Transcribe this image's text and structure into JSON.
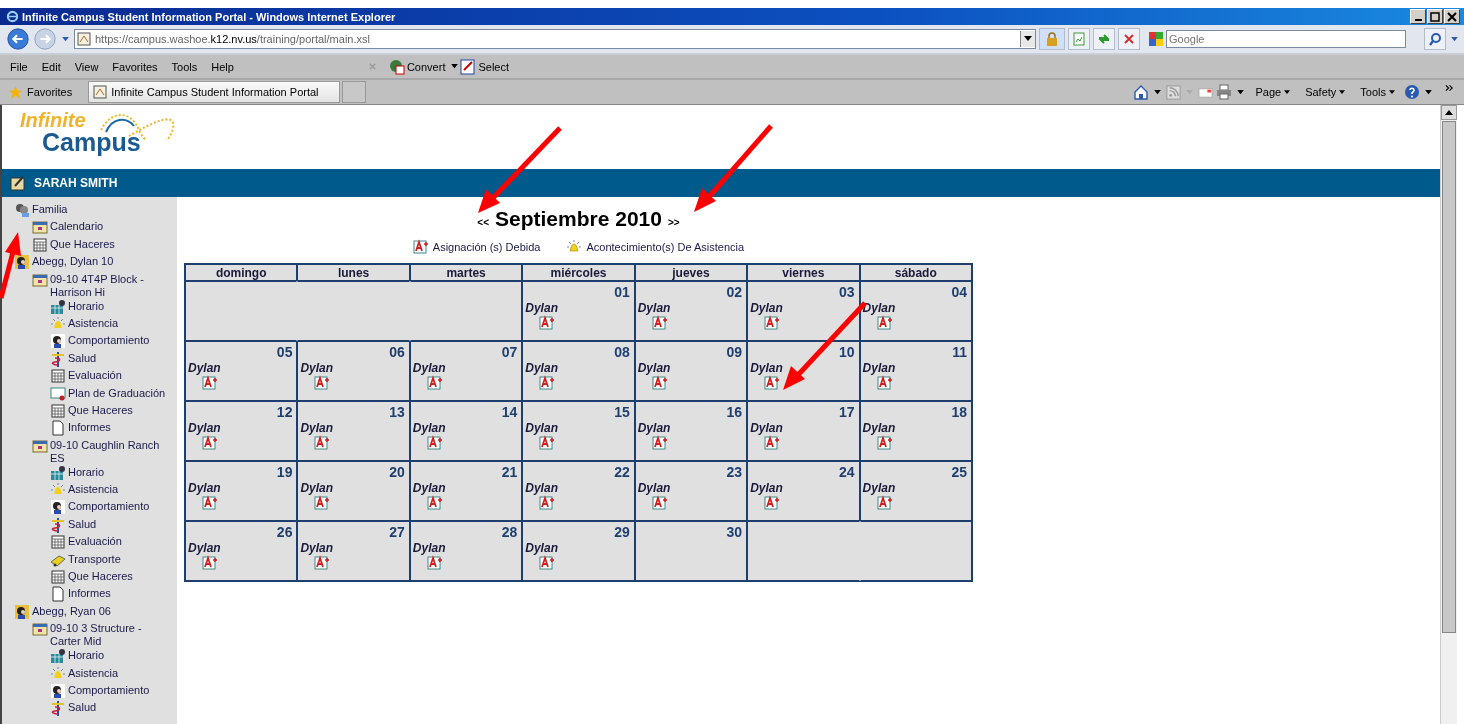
{
  "window": {
    "title": "Infinite Campus Student Information Portal - Windows Internet Explorer"
  },
  "address_bar": {
    "scheme": "https://campus.washoe.",
    "domain": "k12.nv.us",
    "path": "/training/portal/main.xsl"
  },
  "search": {
    "placeholder": "Google"
  },
  "menu": [
    "File",
    "Edit",
    "View",
    "Favorites",
    "Tools",
    "Help"
  ],
  "command_bar": [
    {
      "kind": "convert",
      "label": "Convert"
    },
    {
      "kind": "select",
      "label": "Select"
    }
  ],
  "favorites": {
    "label": "Favorites"
  },
  "tab": {
    "title": "Infinite Campus Student Information Portal"
  },
  "command_menus": [
    "Page",
    "Safety",
    "Tools"
  ],
  "logo": {
    "line1": "Infinite",
    "line2": "Campus"
  },
  "user_bar": {
    "name": "SARAH SMITH"
  },
  "sidebar": {
    "items": [
      {
        "label": "Familia",
        "kind": "family",
        "children": [
          {
            "label": "Calendario",
            "kind": "calendar"
          },
          {
            "label": "Que Haceres",
            "kind": "grid"
          }
        ]
      },
      {
        "label": "Abegg, Dylan 10",
        "kind": "student",
        "children": [
          {
            "label": "09-10 4T4P Block - Harrison Hi",
            "kind": "calendar",
            "children": [
              {
                "label": "Horario",
                "kind": "schedule"
              },
              {
                "label": "Asistencia",
                "kind": "bell"
              },
              {
                "label": "Comportamiento",
                "kind": "behavior"
              },
              {
                "label": "Salud",
                "kind": "health"
              },
              {
                "label": "Evaluación",
                "kind": "grid"
              },
              {
                "label": "Plan de Graduación",
                "kind": "certificate"
              },
              {
                "label": "Que Haceres",
                "kind": "grid"
              },
              {
                "label": "Informes",
                "kind": "document"
              }
            ]
          },
          {
            "label": "09-10 Caughlin Ranch ES",
            "kind": "calendar",
            "children": [
              {
                "label": "Horario",
                "kind": "schedule"
              },
              {
                "label": "Asistencia",
                "kind": "bell"
              },
              {
                "label": "Comportamiento",
                "kind": "behavior"
              },
              {
                "label": "Salud",
                "kind": "health"
              },
              {
                "label": "Evaluación",
                "kind": "grid"
              },
              {
                "label": "Transporte",
                "kind": "bus"
              },
              {
                "label": "Que Haceres",
                "kind": "grid"
              },
              {
                "label": "Informes",
                "kind": "document"
              }
            ]
          }
        ]
      },
      {
        "label": "Abegg, Ryan 06",
        "kind": "student",
        "children": [
          {
            "label": "09-10 3 Structure - Carter Mid",
            "kind": "calendar",
            "children": [
              {
                "label": "Horario",
                "kind": "schedule"
              },
              {
                "label": "Asistencia",
                "kind": "bell"
              },
              {
                "label": "Comportamiento",
                "kind": "behavior"
              },
              {
                "label": "Salud",
                "kind": "health"
              }
            ]
          }
        ]
      }
    ]
  },
  "calendar": {
    "prev": "<<",
    "title": "Septiembre 2010",
    "next": ">>",
    "legend": [
      {
        "kind": "assignment",
        "label": "Asignación (s) Debida"
      },
      {
        "kind": "attendance",
        "label": "Acontecimiento(s) De Asistencia"
      }
    ],
    "weekdays": [
      "domingo",
      "lunes",
      "martes",
      "miércoles",
      "jueves",
      "viernes",
      "sábado"
    ],
    "weeks": [
      [
        {
          "kind": "blank"
        },
        {
          "kind": "blank"
        },
        {
          "kind": "blank"
        },
        {
          "kind": "day",
          "day": "01",
          "events": [
            {
              "name": "Dylan",
              "kind": "assignment"
            }
          ]
        },
        {
          "kind": "day",
          "day": "02",
          "events": [
            {
              "name": "Dylan",
              "kind": "assignment"
            }
          ]
        },
        {
          "kind": "day",
          "day": "03",
          "events": [
            {
              "name": "Dylan",
              "kind": "assignment"
            }
          ]
        },
        {
          "kind": "day",
          "day": "04",
          "events": [
            {
              "name": "Dylan",
              "kind": "assignment"
            }
          ]
        }
      ],
      [
        {
          "kind": "day",
          "day": "05",
          "events": [
            {
              "name": "Dylan",
              "kind": "assignment"
            }
          ]
        },
        {
          "kind": "day",
          "day": "06",
          "events": [
            {
              "name": "Dylan",
              "kind": "assignment"
            }
          ]
        },
        {
          "kind": "day",
          "day": "07",
          "events": [
            {
              "name": "Dylan",
              "kind": "assignment"
            }
          ]
        },
        {
          "kind": "day",
          "day": "08",
          "events": [
            {
              "name": "Dylan",
              "kind": "assignment"
            }
          ]
        },
        {
          "kind": "day",
          "day": "09",
          "events": [
            {
              "name": "Dylan",
              "kind": "assignment"
            }
          ]
        },
        {
          "kind": "day",
          "day": "10",
          "events": [
            {
              "name": "Dylan",
              "kind": "assignment"
            }
          ]
        },
        {
          "kind": "day",
          "day": "11",
          "events": [
            {
              "name": "Dylan",
              "kind": "assignment"
            }
          ]
        }
      ],
      [
        {
          "kind": "day",
          "day": "12",
          "events": [
            {
              "name": "Dylan",
              "kind": "assignment"
            }
          ]
        },
        {
          "kind": "day",
          "day": "13",
          "events": [
            {
              "name": "Dylan",
              "kind": "assignment"
            }
          ]
        },
        {
          "kind": "day",
          "day": "14",
          "events": [
            {
              "name": "Dylan",
              "kind": "assignment"
            }
          ]
        },
        {
          "kind": "day",
          "day": "15",
          "events": [
            {
              "name": "Dylan",
              "kind": "assignment"
            }
          ]
        },
        {
          "kind": "day",
          "day": "16",
          "events": [
            {
              "name": "Dylan",
              "kind": "assignment"
            }
          ]
        },
        {
          "kind": "day",
          "day": "17",
          "events": [
            {
              "name": "Dylan",
              "kind": "assignment"
            }
          ]
        },
        {
          "kind": "day",
          "day": "18",
          "events": [
            {
              "name": "Dylan",
              "kind": "assignment"
            }
          ]
        }
      ],
      [
        {
          "kind": "day",
          "day": "19",
          "events": [
            {
              "name": "Dylan",
              "kind": "assignment"
            }
          ]
        },
        {
          "kind": "day",
          "day": "20",
          "events": [
            {
              "name": "Dylan",
              "kind": "assignment"
            }
          ]
        },
        {
          "kind": "day",
          "day": "21",
          "events": [
            {
              "name": "Dylan",
              "kind": "assignment"
            }
          ]
        },
        {
          "kind": "day",
          "day": "22",
          "events": [
            {
              "name": "Dylan",
              "kind": "assignment"
            }
          ]
        },
        {
          "kind": "day",
          "day": "23",
          "events": [
            {
              "name": "Dylan",
              "kind": "assignment"
            }
          ]
        },
        {
          "kind": "day",
          "day": "24",
          "events": [
            {
              "name": "Dylan",
              "kind": "assignment"
            }
          ]
        },
        {
          "kind": "day",
          "day": "25",
          "events": [
            {
              "name": "Dylan",
              "kind": "assignment"
            }
          ]
        }
      ],
      [
        {
          "kind": "day",
          "day": "26",
          "events": [
            {
              "name": "Dylan",
              "kind": "assignment"
            }
          ]
        },
        {
          "kind": "day",
          "day": "27",
          "events": [
            {
              "name": "Dylan",
              "kind": "assignment"
            }
          ]
        },
        {
          "kind": "day",
          "day": "28",
          "events": [
            {
              "name": "Dylan",
              "kind": "assignment"
            }
          ]
        },
        {
          "kind": "day",
          "day": "29",
          "events": [
            {
              "name": "Dylan",
              "kind": "assignment"
            }
          ]
        },
        {
          "kind": "day",
          "day": "30"
        },
        {
          "kind": "blank"
        },
        {
          "kind": "blank"
        }
      ]
    ]
  }
}
